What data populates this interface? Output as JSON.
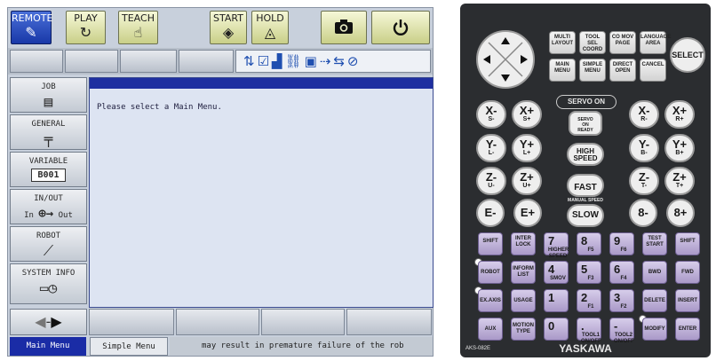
{
  "top_buttons": [
    {
      "label": "REMOTE",
      "icon": "pen-icon",
      "glyph": "✎",
      "active": true
    },
    {
      "label": "PLAY",
      "icon": "rotate-icon",
      "glyph": "↻",
      "active": false
    },
    {
      "label": "TEACH",
      "icon": "hand-icon",
      "glyph": "☝",
      "active": false
    },
    {
      "label": "START",
      "icon": "diamond-icon",
      "glyph": "◈",
      "active": false
    },
    {
      "label": "HOLD",
      "icon": "triangle-icon",
      "glyph": "◬",
      "active": false
    }
  ],
  "camera_icon": "camera-icon",
  "power_icon": "power-icon",
  "status_icons": "⇅☑▟⛓▣⇢⇆⊘",
  "side_menu": {
    "job": {
      "label": "JOB",
      "icon": "document-icon"
    },
    "general": {
      "label": "GENERAL",
      "icon": "arc-welding-icon"
    },
    "variable": {
      "label": "VARIABLE",
      "value": "B001"
    },
    "inout": {
      "label": "IN/OUT",
      "in": "In",
      "out": "Out",
      "icon": "io-icon"
    },
    "robot": {
      "label": "ROBOT",
      "icon": "robot-arm-icon"
    },
    "system_info": {
      "label": "SYSTEM INFO",
      "icon": "system-info-icon"
    }
  },
  "content": {
    "message": "Please select a Main Menu."
  },
  "footer": {
    "main_menu": "Main Menu",
    "simple_menu": "Simple Menu",
    "status_text": "may result in premature failure of the rob"
  },
  "pendant": {
    "model": "AKS-082E",
    "brand": "YASKAWA",
    "select": "SELECT",
    "servo_on": "SERVO ON",
    "servo_on_ready": [
      "SERVO",
      "ON",
      "READY"
    ],
    "high_speed": [
      "HIGH",
      "SPEED"
    ],
    "fast": "FAST",
    "manual_speed": "MANUAL SPEED",
    "slow": "SLOW",
    "top_keys": [
      {
        "top": "MULTI",
        "label": "LAYOUT"
      },
      {
        "top": "TOOL SEL",
        "label": "COORD"
      },
      {
        "top": "CO MOV",
        "label": "PAGE"
      },
      {
        "top": "LANGUAGE",
        "label": "AREA"
      },
      {
        "top": "",
        "label": "MAIN MENU"
      },
      {
        "top": "",
        "label": "SIMPLE MENU"
      },
      {
        "top": "",
        "label": "DIRECT OPEN"
      },
      {
        "top": "",
        "label": "CANCEL"
      }
    ],
    "axis_left": [
      [
        "X-",
        "S-"
      ],
      [
        "X+",
        "S+"
      ],
      [
        "Y-",
        "L-"
      ],
      [
        "Y+",
        "L+"
      ],
      [
        "Z-",
        "U-"
      ],
      [
        "Z+",
        "U+"
      ],
      [
        "E-",
        ""
      ],
      [
        "E+",
        ""
      ]
    ],
    "axis_right": [
      [
        "X-",
        "R-"
      ],
      [
        "X+",
        "R+"
      ],
      [
        "Y-",
        "B-"
      ],
      [
        "Y+",
        "B+"
      ],
      [
        "Z-",
        "T-"
      ],
      [
        "Z+",
        "T+"
      ],
      [
        "8-",
        ""
      ],
      [
        "8+",
        ""
      ]
    ],
    "lower_keys": {
      "shift_l": "SHIFT",
      "interlock": "INTER LOCK",
      "seven": "7",
      "seven_sub": "HIGHER SPEED",
      "eight": "8",
      "eight_sub": "F5",
      "nine": "9",
      "nine_sub": "F6",
      "test_start": "TEST START",
      "shift_r": "SHIFT",
      "robot": "ROBOT",
      "inform_list": "INFORM LIST",
      "four": "4",
      "four_sub": "SMOV",
      "five": "5",
      "five_sub": "F3",
      "six": "6",
      "six_sub": "F4",
      "bwd": "BWD",
      "fwd": "FWD",
      "ex_axis": "EX.AXIS",
      "usage": "USAGE",
      "one": "1",
      "two": "2",
      "two_sub": "F1",
      "three": "3",
      "three_sub": "F2",
      "delete": "DELETE",
      "insert": "INSERT",
      "aux": "AUX",
      "motion_type": "MOTION TYPE",
      "zero": "0",
      "dot": ".",
      "dot_sub": "TOOL1 ON/OFF",
      "minus": "-",
      "minus_sub": "TOOL2 ON/OFF",
      "modify": "MODIFY",
      "enter": "ENTER"
    }
  }
}
